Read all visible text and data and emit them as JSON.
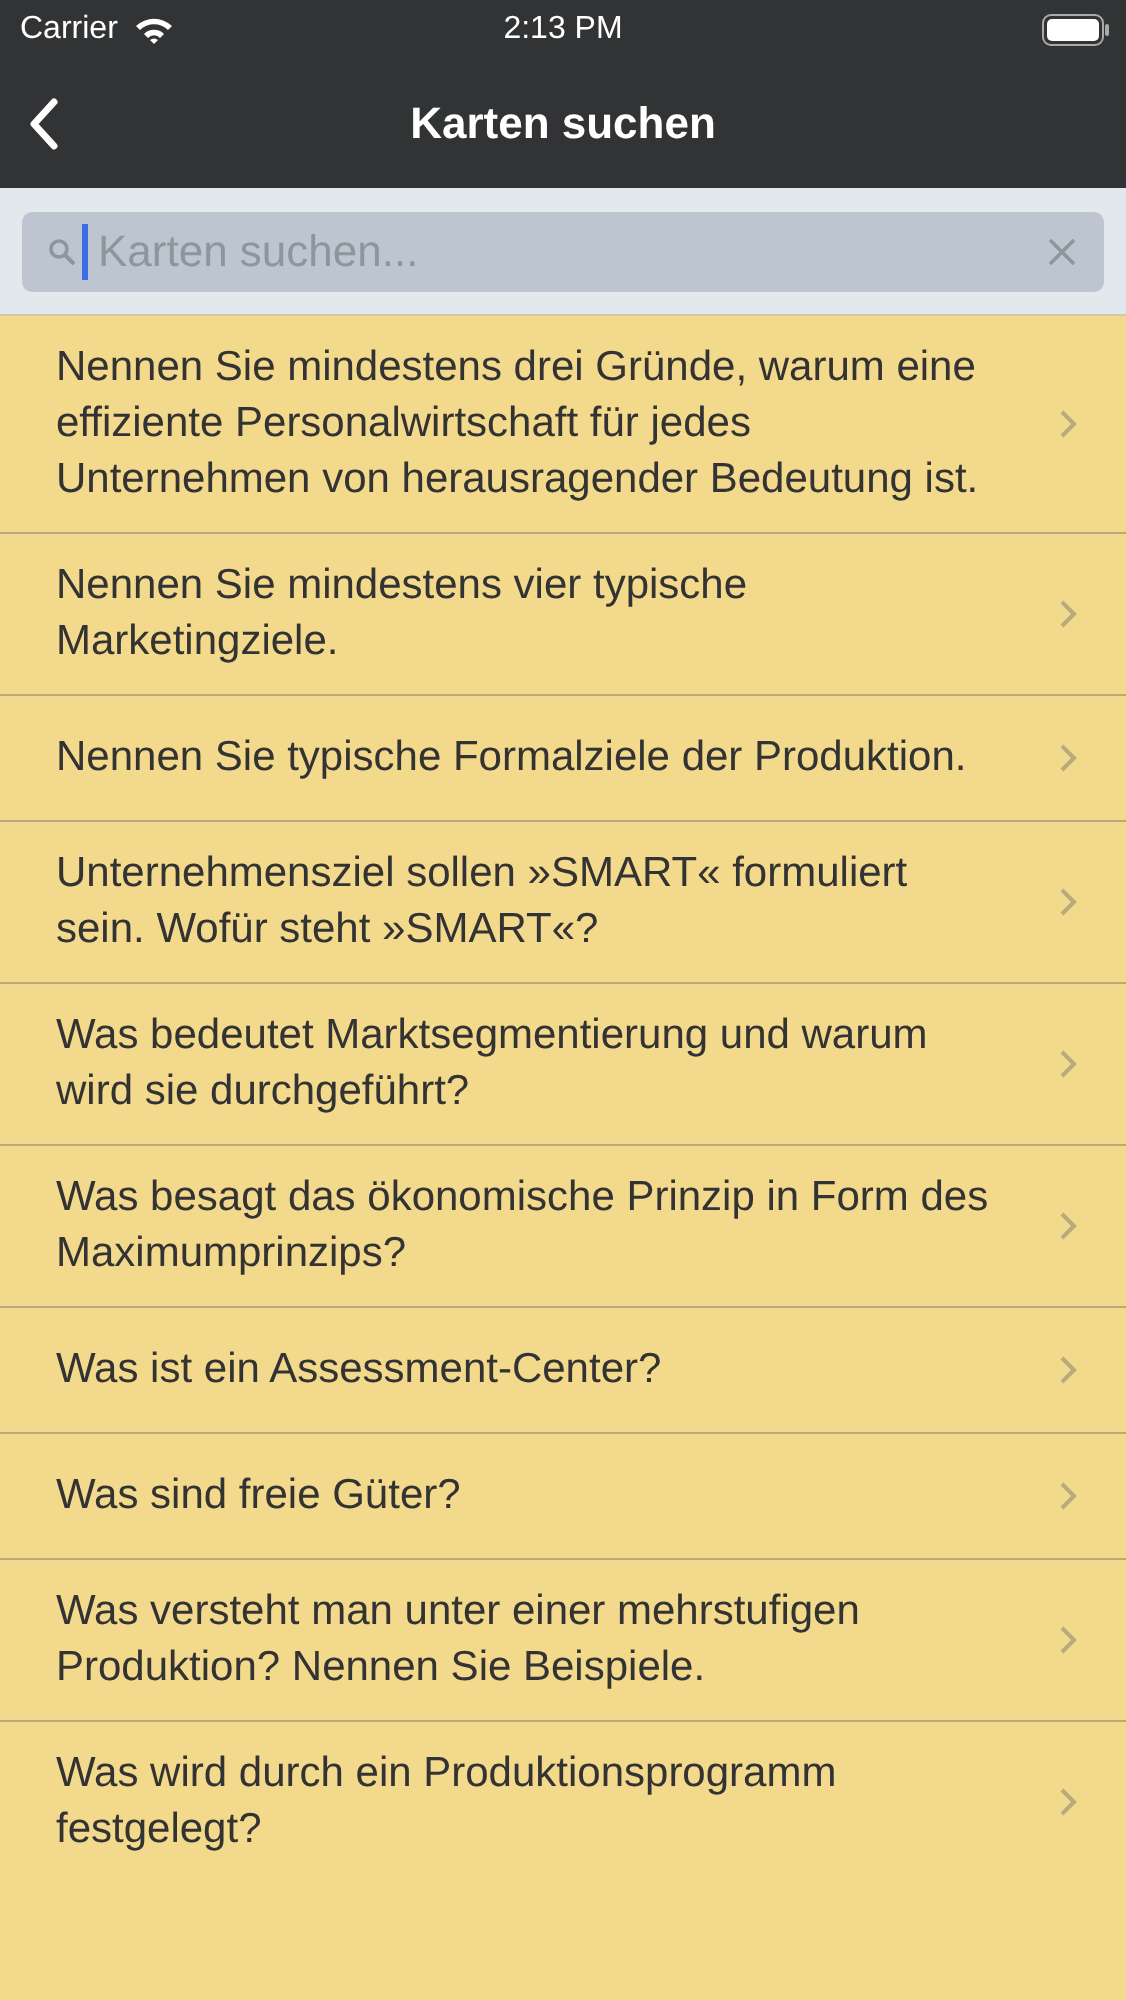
{
  "status_bar": {
    "carrier": "Carrier",
    "time": "2:13 PM"
  },
  "nav": {
    "title": "Karten suchen"
  },
  "search": {
    "placeholder": "Karten suchen..."
  },
  "cards": [
    {
      "text": "Nennen Sie mindestens drei Gründe, warum eine effiziente Personalwirtschaft für jedes Unternehmen von herausragender Bedeutung ist."
    },
    {
      "text": "Nennen Sie mindestens vier typische Marketingziele."
    },
    {
      "text": "Nennen Sie typische Formalziele der Produktion."
    },
    {
      "text": "Unternehmensziel sollen »SMART« formuliert sein. Wofür steht »SMART«?"
    },
    {
      "text": "Was bedeutet Marktsegmentierung und warum wird sie durchgeführt?"
    },
    {
      "text": "Was besagt das ökonomische Prinzip in Form des Maximumprinzips?"
    },
    {
      "text": "Was ist ein Assessment-Center?"
    },
    {
      "text": "Was sind freie Güter?"
    },
    {
      "text": "Was versteht man unter einer mehrstufigen Produktion? Nennen Sie Beispiele."
    },
    {
      "text": "Was wird durch ein Produktionsprogramm festgelegt?"
    }
  ]
}
